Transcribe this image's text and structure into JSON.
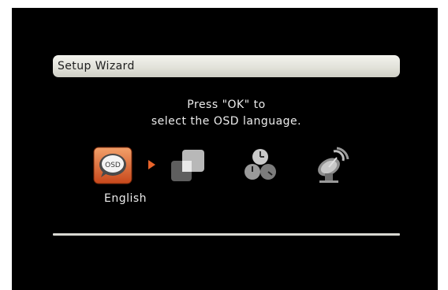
{
  "wizard": {
    "title": "Setup Wizard",
    "message_line1": "Press \"OK\" to",
    "message_line2": "select the OSD language.",
    "steps": [
      {
        "icon": "osd-language-icon",
        "badge": "OSD",
        "label": "English",
        "active": true
      },
      {
        "icon": "display-settings-icon"
      },
      {
        "icon": "time-settings-icon"
      },
      {
        "icon": "satellite-dish-icon"
      }
    ]
  },
  "colors": {
    "background": "#000000",
    "title_bar": "#e2e2da",
    "active_accent": "#e8632a",
    "text": "#ececec"
  }
}
